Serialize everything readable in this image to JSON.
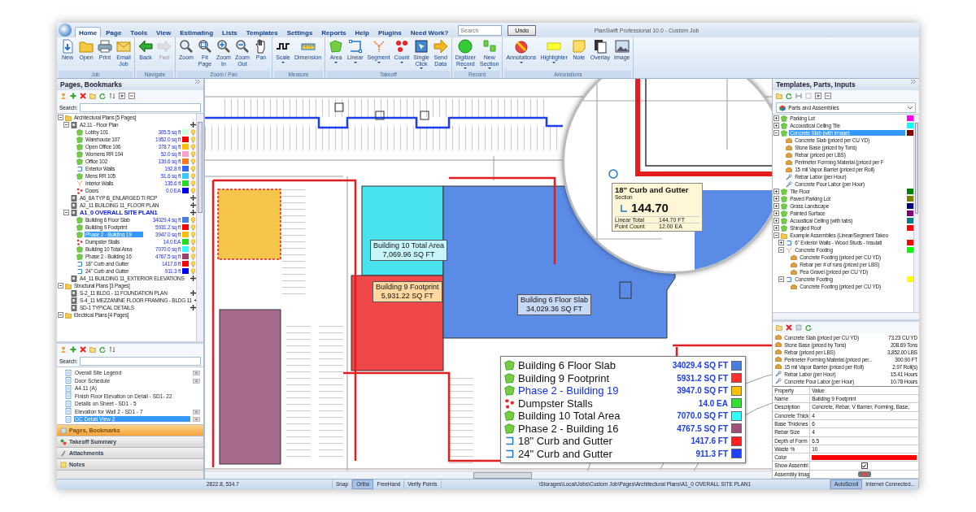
{
  "app_title": "PlanSwift Professional 10.0 - Custom Job",
  "menu_tabs": [
    {
      "label": "Home",
      "selected": true
    },
    {
      "label": "Page",
      "selected": false
    },
    {
      "label": "Tools",
      "selected": false
    },
    {
      "label": "View",
      "selected": false
    },
    {
      "label": "Estimating",
      "selected": false
    },
    {
      "label": "Lists",
      "selected": false
    },
    {
      "label": "Templates",
      "selected": false
    },
    {
      "label": "Settings",
      "selected": false
    },
    {
      "label": "Reports",
      "selected": false
    },
    {
      "label": "Help",
      "selected": false
    },
    {
      "label": "Plugins",
      "selected": false
    },
    {
      "label": "Need Work?",
      "selected": false
    }
  ],
  "search": {
    "placeholder": "Search"
  },
  "undo_button": "Undo",
  "ribbon_groups": [
    {
      "label": "Job",
      "buttons": [
        {
          "label": "New",
          "dropdown": false,
          "disabled": false
        },
        {
          "label": "Open",
          "dropdown": false,
          "disabled": false
        },
        {
          "label": "Print",
          "dropdown": false,
          "disabled": false
        },
        {
          "label": "Email\nJob",
          "dropdown": false,
          "disabled": false
        }
      ]
    },
    {
      "label": "Navigate",
      "buttons": [
        {
          "label": "Back",
          "dropdown": false,
          "disabled": false
        },
        {
          "label": "Fwd",
          "dropdown": false,
          "disabled": true
        }
      ]
    },
    {
      "label": "Zoom / Pan",
      "buttons": [
        {
          "label": "Zoom",
          "dropdown": false,
          "disabled": false
        },
        {
          "label": "Fit\nPage",
          "dropdown": false,
          "disabled": false
        },
        {
          "label": "Zoom\nIn",
          "dropdown": false,
          "disabled": false
        },
        {
          "label": "Zoom\nOut",
          "dropdown": false,
          "disabled": false
        },
        {
          "label": "Pan",
          "dropdown": false,
          "disabled": false
        }
      ]
    },
    {
      "label": "Measure",
      "buttons": [
        {
          "label": "Scale",
          "dropdown": true,
          "disabled": false
        },
        {
          "label": "Dimension",
          "dropdown": false,
          "disabled": false
        }
      ]
    },
    {
      "label": "Takeoff",
      "buttons": [
        {
          "label": "Area",
          "dropdown": true,
          "disabled": false
        },
        {
          "label": "Linear",
          "dropdown": true,
          "disabled": false
        },
        {
          "label": "Segment",
          "dropdown": true,
          "disabled": false
        },
        {
          "label": "Count",
          "dropdown": true,
          "disabled": false
        },
        {
          "label": "Single\nClick",
          "dropdown": true,
          "disabled": false
        },
        {
          "label": "Send\nData",
          "dropdown": false,
          "disabled": false
        }
      ]
    },
    {
      "label": "Record",
      "buttons": [
        {
          "label": "Digitizer\nRecord",
          "dropdown": true,
          "disabled": false
        },
        {
          "label": "New\nSection",
          "dropdown": true,
          "disabled": false
        }
      ]
    },
    {
      "label": "Annotations",
      "buttons": [
        {
          "label": "Annotations",
          "dropdown": true,
          "disabled": false
        },
        {
          "label": "Highlighter",
          "dropdown": true,
          "disabled": false
        },
        {
          "label": "Note",
          "dropdown": false,
          "disabled": false
        },
        {
          "label": "Overlay",
          "dropdown": false,
          "disabled": false
        },
        {
          "label": "Image",
          "dropdown": false,
          "disabled": false
        }
      ]
    }
  ],
  "pages_panel": {
    "title": "Pages, Bookmarks",
    "search_label": "Search:",
    "tree": [
      {
        "label": "Architectural Plans [5 Pages]",
        "kind": "folder",
        "expanded": true,
        "selected": false,
        "children": [
          {
            "label": "A2.11 - Floor Plan",
            "kind": "page",
            "active": false,
            "expanded": true,
            "selected": false,
            "children": [
              {
                "label": "Lobby 101",
                "kind": "area",
                "value": "305.5 sq ft",
                "color": "#ccffdd",
                "selected": false
              },
              {
                "label": "Warehouse 107",
                "kind": "area",
                "value": "1952.0 sq ft",
                "color": "#ff0000",
                "selected": false
              },
              {
                "label": "Open Office 106",
                "kind": "area",
                "value": "378.7 sq ft",
                "color": "#ffc000",
                "selected": false
              },
              {
                "label": "Womens RR 104",
                "kind": "area",
                "value": "52.0 sq ft",
                "color": "#ffa0c8",
                "selected": false
              },
              {
                "label": "Office 102",
                "kind": "area",
                "value": "139.6 sq ft",
                "color": "#ff7a20",
                "selected": false
              },
              {
                "label": "Exterior Walls",
                "kind": "linear",
                "value": "192.8 ft",
                "color": "#3366ff",
                "selected": false
              },
              {
                "label": "Mens RR 105",
                "kind": "area",
                "value": "51.6 sq ft",
                "color": "#33ccff",
                "selected": false
              },
              {
                "label": "Interior Walls",
                "kind": "segment",
                "value": "135.6 ft",
                "color": "#22dd22",
                "selected": false
              },
              {
                "label": "Doors",
                "kind": "count",
                "value": "0.0 EA",
                "color": "#0000ff",
                "selected": false
              }
            ]
          },
          {
            "label": "A6_6A TYP B_ENLARGED TI RCP",
            "kind": "page",
            "active": false,
            "selected": false
          },
          {
            "label": "A2_11 BUILDING 11_FLOOR PLAN",
            "kind": "page",
            "active": false,
            "selected": false
          },
          {
            "label": "A1_0 OVERALL SITE PLAN1",
            "kind": "page",
            "active": true,
            "expanded": true,
            "selected": false,
            "children": [
              {
                "label": "Building 6 Floor Slab",
                "kind": "area",
                "value": "34029.4 sq ft",
                "color": "#4a7fe0",
                "selected": false
              },
              {
                "label": "Building 9 Footprint",
                "kind": "area",
                "value": "5931.2 sq ft",
                "color": "#ff0000",
                "selected": false
              },
              {
                "label": "Phase 2 - Building 19",
                "kind": "area",
                "value": "3947.0 sq ft",
                "color": "#ffc000",
                "selected": true
              },
              {
                "label": "Dumpster Stalls",
                "kind": "count",
                "value": "14.0 EA",
                "color": "#22dd22",
                "selected": false
              },
              {
                "label": "Building 10 Total Area",
                "kind": "area",
                "value": "7070.0 sq ft",
                "color": "#33ffff",
                "selected": false
              },
              {
                "label": "Phase 2 - Building 16",
                "kind": "area",
                "value": "4767.5 sq ft",
                "color": "#a0406a",
                "selected": false
              },
              {
                "label": "18\" Curb and Gutter",
                "kind": "linear",
                "value": "1417.6 ft",
                "color": "#ff0000",
                "selected": false
              },
              {
                "label": "24\" Curb and Gutter",
                "kind": "linear",
                "value": "911.3 ft",
                "color": "#0000ff",
                "selected": false
              }
            ]
          },
          {
            "label": "A4_11 BUILDING 11_EXTERIOR ELEVATIONS",
            "kind": "page",
            "active": false,
            "selected": false
          }
        ]
      },
      {
        "label": "Structural Plans [3 Pages]",
        "kind": "folder",
        "expanded": true,
        "selected": false,
        "children": [
          {
            "label": "S-2_11 BLDG - 11 FOUNDATION PLAN",
            "kind": "page",
            "active": false,
            "selected": false
          },
          {
            "label": "S-4_11 MEZZANINE FLOOR FRAMING - BLDG 11",
            "kind": "page",
            "active": false,
            "selected": false
          },
          {
            "label": "SD-1 TYPICAL DETAILS",
            "kind": "page",
            "active": false,
            "selected": false
          }
        ]
      },
      {
        "label": "Electrical Plans [4 Pages]",
        "kind": "folder",
        "expanded": true,
        "selected": false
      }
    ]
  },
  "bookmarks_panel": {
    "search_label": "Search:",
    "items": [
      {
        "label": "Overall Site Legend",
        "snapshot": true,
        "selected": false
      },
      {
        "label": "Door Schedule",
        "snapshot": true,
        "selected": false
      },
      {
        "label": "A4.11 (A)",
        "snapshot": false,
        "selected": false
      },
      {
        "label": "Finish Floor Elevation on Detail - SD1- 22",
        "snapshot": false,
        "selected": false
      },
      {
        "label": "Details on Sheet - SD1 - 5",
        "snapshot": false,
        "selected": false
      },
      {
        "label": "Elevation for Wall 2 - SD1 - 7",
        "snapshot": true,
        "selected": false
      },
      {
        "label": "GC Detail View 2",
        "snapshot": true,
        "selected": true
      }
    ]
  },
  "accordion": [
    {
      "label": "Pages, Bookmarks",
      "selected": true
    },
    {
      "label": "Takeoff Summary",
      "selected": false
    },
    {
      "label": "Attachments",
      "selected": false
    },
    {
      "label": "Notes",
      "selected": false
    }
  ],
  "canvas": {
    "area_labels": [
      {
        "name": "Building 10 Total Area",
        "value": "7,069.96 SQ FT"
      },
      {
        "name": "Building 9 Footprint",
        "value": "5,931.22 SQ FT"
      },
      {
        "name": "Building 6 Floor Slab",
        "value": "34,029.36 SQ FT"
      }
    ],
    "tooltip": {
      "title": "18\" Curb and Gutter",
      "subtitle": "Section",
      "total": "144.70",
      "rows": [
        {
          "label": "Linear Total",
          "value": "144.70 FT"
        },
        {
          "label": "Point Count",
          "value": "12.00 EA"
        }
      ]
    },
    "legend": [
      {
        "kind": "area",
        "name": "Building 6 Floor Slab",
        "value": "34029.4 SQ FT",
        "color": "#4a7fe0",
        "selected": false
      },
      {
        "kind": "area",
        "name": "Building 9 Footprint",
        "value": "5931.2 SQ FT",
        "color": "#ff3030",
        "selected": false
      },
      {
        "kind": "area",
        "name": "Phase 2 - Building 19",
        "value": "3947.0 SQ FT",
        "color": "#ffc000",
        "selected": true
      },
      {
        "kind": "count",
        "name": "Dumpster Stalls",
        "value": "14.0 EA",
        "color": "#33dd33",
        "selected": false
      },
      {
        "kind": "area",
        "name": "Building 10 Total Area",
        "value": "7070.0 SQ FT",
        "color": "#33ffff",
        "selected": false
      },
      {
        "kind": "area",
        "name": "Phase 2 - Building 16",
        "value": "4767.5 SQ FT",
        "color": "#a0507a",
        "selected": false
      },
      {
        "kind": "linear",
        "name": "18\" Curb and Gutter",
        "value": "1417.6 FT",
        "color": "#ff2020",
        "selected": false
      },
      {
        "kind": "linear",
        "name": "24\" Curb and Gutter",
        "value": "911.3 FT",
        "color": "#2040ff",
        "selected": false
      }
    ]
  },
  "templates_panel": {
    "title": "Templates, Parts, Inputs",
    "dropdown": "Parts and Assemblies",
    "tree": [
      {
        "label": "Parking Lot",
        "kind": "area",
        "color": "#ff00ff",
        "expanded": false,
        "selected": false
      },
      {
        "label": "Accoustical Ceiling Tile",
        "kind": "area",
        "color": "#00ffff",
        "expanded": false,
        "selected": false
      },
      {
        "label": "Concrete Slab (with image)",
        "kind": "area",
        "color": "#800000",
        "expanded": true,
        "selected": true,
        "children": [
          {
            "label": "Concrete Slab (priced per CU YD)",
            "kind": "part",
            "selected": false
          },
          {
            "label": "Stone Base (priced by Tons)",
            "kind": "part",
            "selected": false
          },
          {
            "label": "Rebar (priced per LBS)",
            "kind": "part",
            "selected": false
          },
          {
            "label": "Perimeter Forming Material (priced per F",
            "kind": "part",
            "selected": false
          },
          {
            "label": "15 mil Vapor Barrier (priced per Roll)",
            "kind": "part",
            "selected": false
          },
          {
            "label": "Rebar Labor (per Hour)",
            "kind": "labor",
            "selected": false
          },
          {
            "label": "Concrete Pour Labor (per Hour)",
            "kind": "labor",
            "selected": false
          }
        ]
      },
      {
        "label": "Tile Floor",
        "kind": "area",
        "color": "#008000",
        "expanded": false,
        "selected": false
      },
      {
        "label": "Paved Parking Lot",
        "kind": "area",
        "color": "#808000",
        "expanded": false,
        "selected": false
      },
      {
        "label": "Grass Landscape",
        "kind": "area",
        "color": "#000080",
        "expanded": false,
        "selected": false
      },
      {
        "label": "Painted Surface",
        "kind": "area",
        "color": "#800080",
        "expanded": false,
        "selected": false
      },
      {
        "label": "Acoustical Ceiling (with tabs)",
        "kind": "area",
        "color": "#008080",
        "expanded": false,
        "selected": false
      },
      {
        "label": "Shingled Roof",
        "kind": "area",
        "color": "#ff0000",
        "expanded": false,
        "selected": false
      },
      {
        "label": "Example Assemblies (Linear/Segment Takeo",
        "kind": "folder",
        "expanded": true,
        "selected": false,
        "children": [
          {
            "label": "6\" Exterior Walls - Wood Studs - Insulati",
            "kind": "linear",
            "color": "#ff0000",
            "expanded": false,
            "selected": false
          },
          {
            "label": "Concrete Footing",
            "kind": "segment",
            "color": "#00ff00",
            "expanded": true,
            "selected": false,
            "children": [
              {
                "label": "Concrete Footing (priced per CU YD)",
                "kind": "part",
                "selected": false
              },
              {
                "label": "Rebar per # of runs (priced per LBS)",
                "kind": "part",
                "selected": false
              },
              {
                "label": "Pea Gravel (priced per CU YD)",
                "kind": "part",
                "selected": false
              }
            ]
          },
          {
            "label": "Concrete Footing",
            "kind": "linear",
            "color": "#ffff00",
            "expanded": true,
            "selected": false,
            "children": [
              {
                "label": "Concrete Footing (priced per CU YD)",
                "kind": "part",
                "selected": false
              }
            ]
          }
        ]
      }
    ],
    "parts": [
      {
        "kind": "part",
        "label": "Concrete Slab (priced per CU YD)",
        "value": "73.23 CU YD"
      },
      {
        "kind": "part",
        "label": "Stone Base (priced by Tons)",
        "value": "208.69 Tons"
      },
      {
        "kind": "part",
        "label": "Rebar (priced per LBS)",
        "value": "3,852.00 LBS"
      },
      {
        "kind": "part",
        "label": "Perimeter Forming Material (priced per...",
        "value": "300.90 FT"
      },
      {
        "kind": "part",
        "label": "15 mil Vapor Barrier (priced per Roll)",
        "value": "2.97 Roll(s)"
      },
      {
        "kind": "labor",
        "label": "Rebar Labor (per Hour)",
        "value": "15.41 Hours"
      },
      {
        "kind": "labor",
        "label": "Concrete Pour Labor (per Hour)",
        "value": "10.78 Hours"
      }
    ],
    "properties": {
      "columns": [
        "Property",
        "Value"
      ],
      "rows": [
        {
          "property": "Name",
          "kind": "text",
          "value": "Building 9 Footprint"
        },
        {
          "property": "Description",
          "kind": "text",
          "value": "Concrete, Rebar, V Barrier, Forming, Base,"
        },
        {
          "property": "Concrete Thick",
          "kind": "text",
          "value": "4"
        },
        {
          "property": "Base Thicknes",
          "kind": "text",
          "value": "6"
        },
        {
          "property": "Rebar Size",
          "kind": "text",
          "value": "4"
        },
        {
          "property": "Depth of Form",
          "kind": "text",
          "value": "6.5"
        },
        {
          "property": "Waste %",
          "kind": "text",
          "value": "10"
        },
        {
          "property": "Color",
          "kind": "color",
          "color": "#ff0000"
        },
        {
          "property": "Show Assembl",
          "kind": "checkbox",
          "checked": true
        },
        {
          "property": "Assembly Imag",
          "kind": "image"
        }
      ]
    }
  },
  "status_bar": {
    "coordinates": "2822.8, 534.7",
    "toggles": [
      {
        "label": "Snap",
        "on": false
      },
      {
        "label": "Ortho",
        "on": true
      },
      {
        "label": "FreeHand",
        "on": false
      },
      {
        "label": "Verify Points",
        "on": false
      }
    ],
    "path": "\\Storages\\Local\\Jobs\\Custom Job\\Pages\\Architectural Plans\\A1_0 OVERALL SITE PLAN1",
    "auto_scroll": {
      "label": "AutoScroll",
      "on": true
    },
    "connection": "Internet Connected..."
  }
}
